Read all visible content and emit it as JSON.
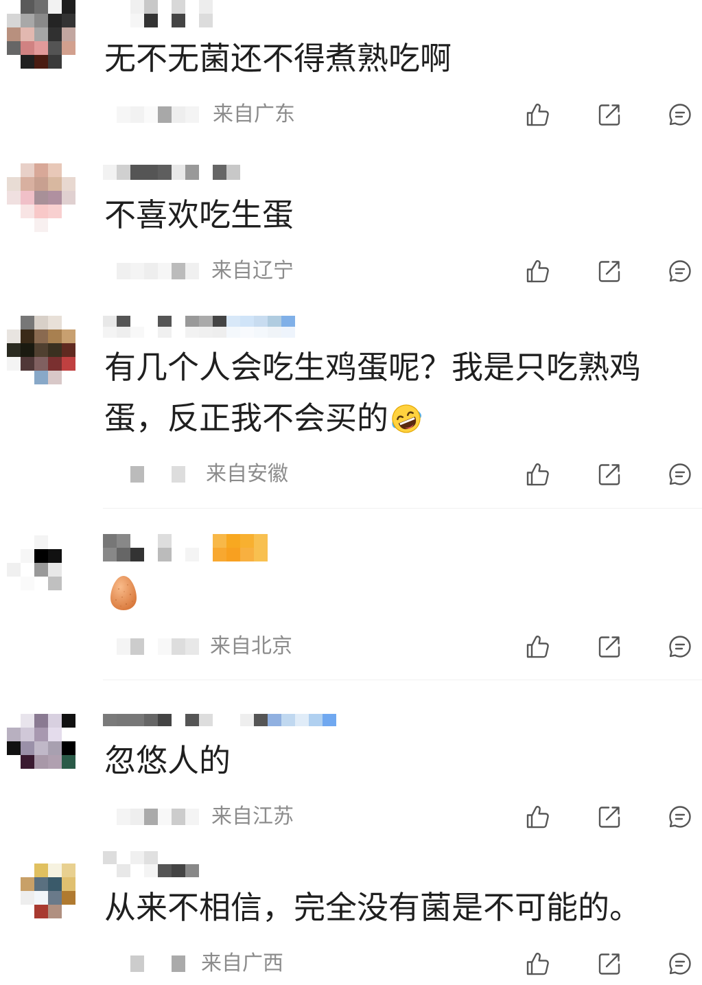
{
  "comments": [
    {
      "text": "无不无菌还不得煮熟吃啊",
      "location": "来自广东"
    },
    {
      "text": "不喜欢吃生蛋",
      "location": "来自辽宁"
    },
    {
      "text": "有几个人会吃生鸡蛋呢？我是只吃熟鸡蛋，反正我不会买的",
      "emoji": "laughing-crying-emoji",
      "location": "来自安徽"
    },
    {
      "emoji": "egg-emoji",
      "location": "来自北京"
    },
    {
      "text": "忽悠人的",
      "location": "来自江苏"
    },
    {
      "text": "从来不相信，完全没有菌是不可能的。",
      "location": "来自广西"
    }
  ],
  "actions": [
    "like-icon",
    "share-icon",
    "comment-icon"
  ],
  "colors": {
    "text": "#1f1f1f",
    "meta": "#8c8c8c",
    "icon": "#555555",
    "background": "#ffffff"
  }
}
